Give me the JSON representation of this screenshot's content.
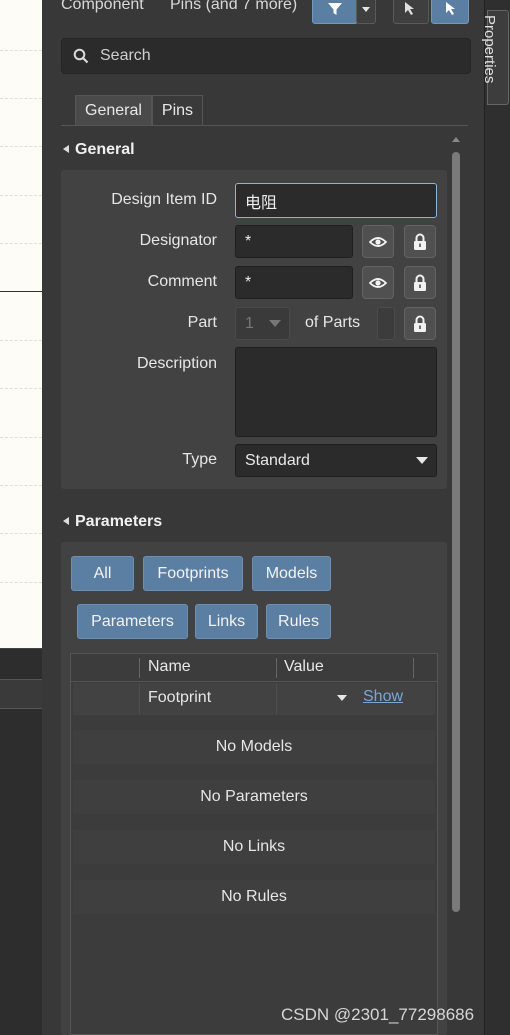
{
  "toolbar": {
    "component_label": "Component",
    "pins_label": "Pins (and 7 more)"
  },
  "search": {
    "placeholder": "Search"
  },
  "tabs": [
    {
      "label": "General",
      "active": true
    },
    {
      "label": "Pins",
      "active": false
    }
  ],
  "general": {
    "title": "General",
    "design_item_id": {
      "label": "Design Item ID",
      "value": "电阻"
    },
    "designator": {
      "label": "Designator",
      "value": "*"
    },
    "comment": {
      "label": "Comment",
      "value": "*"
    },
    "part": {
      "label": "Part",
      "value": "1",
      "of_parts_label": "of Parts"
    },
    "description": {
      "label": "Description",
      "value": ""
    },
    "type": {
      "label": "Type",
      "value": "Standard"
    }
  },
  "parameters": {
    "title": "Parameters",
    "filter_buttons_row1": [
      "All",
      "Footprints",
      "Models"
    ],
    "filter_buttons_row2": [
      "Parameters",
      "Links",
      "Rules"
    ],
    "columns": {
      "name": "Name",
      "value": "Value"
    },
    "footprint_row": {
      "name": "Footprint",
      "action": "Show"
    },
    "empty_rows": [
      "No Models",
      "No Parameters",
      "No Links",
      "No Rules"
    ]
  },
  "side_tab": {
    "label": "Properties"
  },
  "watermark": "CSDN @2301_77298686",
  "colors": {
    "accent_button": "#5b7ea3",
    "focus_border": "#8fb2d8",
    "link": "#7aa6d6"
  }
}
